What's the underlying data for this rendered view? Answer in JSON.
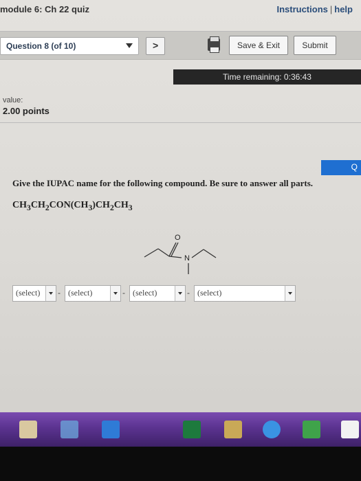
{
  "header": {
    "module_title": "module 6: Ch 22 quiz",
    "instructions_link": "Instructions",
    "help_link": "help",
    "separator": "|"
  },
  "nav": {
    "question_selector": "Question 8 (of 10)",
    "next_glyph": ">",
    "save_exit_label": "Save & Exit",
    "submit_label": "Submit"
  },
  "timer": {
    "text": "Time remaining: 0:36:43"
  },
  "score": {
    "label": "value:",
    "points": "2.00 points"
  },
  "question": {
    "corner_glyph": "Q",
    "prompt": "Give the IUPAC name for the following compound. Be sure to answer all parts.",
    "formula_parts": [
      "CH",
      "3",
      "CH",
      "2",
      "CON(CH",
      "3",
      ")CH",
      "2",
      "CH",
      "3"
    ],
    "structure_labels": {
      "oxygen": "O",
      "nitrogen": "N"
    },
    "selects": [
      {
        "value": "(select)"
      },
      {
        "value": "(select)"
      },
      {
        "value": "(select)"
      },
      {
        "value": "(select)"
      }
    ],
    "dash": "-"
  },
  "taskbar": {
    "icons": [
      "file-explorer-icon",
      "network-icon",
      "outlook-icon",
      "excel-icon",
      "folder-icon",
      "internet-explorer-icon",
      "app-icon",
      "amazon-icon"
    ]
  },
  "colors": {
    "timer_bg": "#262626",
    "accent_blue": "#1f6fd1",
    "taskbar_purple": "#5b3390",
    "link_blue": "#2a4d7a"
  }
}
